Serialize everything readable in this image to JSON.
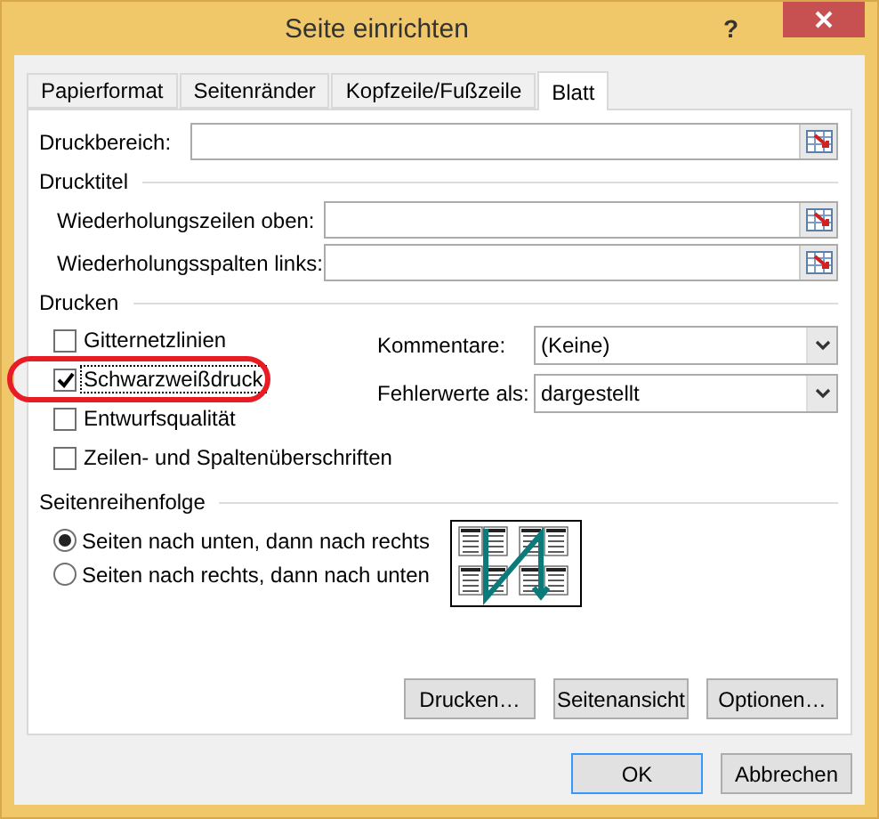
{
  "window": {
    "title": "Seite einrichten",
    "help": "?"
  },
  "tabs": [
    {
      "label": "Papierformat",
      "selected": false
    },
    {
      "label": "Seitenränder",
      "selected": false
    },
    {
      "label": "Kopfzeile/Fußzeile",
      "selected": false
    },
    {
      "label": "Blatt",
      "selected": true
    }
  ],
  "print_area": {
    "label": "Druckbereich:"
  },
  "print_titles": {
    "heading": "Drucktitel",
    "rows": [
      {
        "label": "Wiederholungszeilen oben:"
      },
      {
        "label": "Wiederholungsspalten links:"
      }
    ]
  },
  "print": {
    "heading": "Drucken",
    "options": [
      {
        "label": "Gitternetzlinien",
        "checked": false,
        "focused": false
      },
      {
        "label": "Schwarzweißdruck",
        "checked": true,
        "focused": true
      },
      {
        "label": "Entwurfsqualität",
        "checked": false,
        "focused": false
      },
      {
        "label": "Zeilen- und Spaltenüberschriften",
        "checked": false,
        "focused": false
      }
    ],
    "dropdowns": [
      {
        "label": "Kommentare:",
        "value": "(Keine)"
      },
      {
        "label": "Fehlerwerte als:",
        "value": "dargestellt"
      }
    ]
  },
  "page_order": {
    "heading": "Seitenreihenfolge",
    "options": [
      {
        "label": "Seiten nach unten, dann nach rechts",
        "selected": true
      },
      {
        "label": "Seiten nach rechts, dann nach unten",
        "selected": false
      }
    ]
  },
  "panel_buttons": [
    "Drucken…",
    "Seitenansicht",
    "Optionen…"
  ],
  "footer_buttons": [
    {
      "label": "OK",
      "default": true
    },
    {
      "label": "Abbrechen",
      "default": false
    }
  ],
  "annotations": [
    {
      "kind": "oval"
    }
  ]
}
